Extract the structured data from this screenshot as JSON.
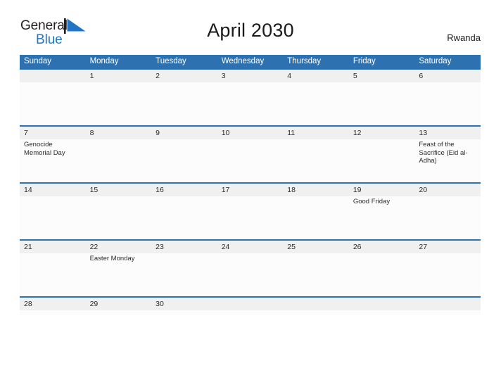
{
  "brand": {
    "line1": "General",
    "line2": "Blue",
    "flag_icon": "blue-triangle-flag-icon",
    "text_color": "#231f20",
    "accent_color": "#2076c4"
  },
  "header": {
    "title": "April 2030",
    "locale": "Rwanda"
  },
  "theme": {
    "header_blue": "#2e71b0",
    "daynum_band": "#f0f0f0",
    "cell_background": "#fcfcfc",
    "text": "#2b2b2b"
  },
  "calendar": {
    "month": "April",
    "year": "2030",
    "country": "Rwanda",
    "weekday_headers": [
      "Sunday",
      "Monday",
      "Tuesday",
      "Wednesday",
      "Thursday",
      "Friday",
      "Saturday"
    ],
    "weeks": [
      [
        {
          "day": "",
          "events": []
        },
        {
          "day": "1",
          "events": []
        },
        {
          "day": "2",
          "events": []
        },
        {
          "day": "3",
          "events": []
        },
        {
          "day": "4",
          "events": []
        },
        {
          "day": "5",
          "events": []
        },
        {
          "day": "6",
          "events": []
        }
      ],
      [
        {
          "day": "7",
          "events": [
            "Genocide Memorial Day"
          ]
        },
        {
          "day": "8",
          "events": []
        },
        {
          "day": "9",
          "events": []
        },
        {
          "day": "10",
          "events": []
        },
        {
          "day": "11",
          "events": []
        },
        {
          "day": "12",
          "events": []
        },
        {
          "day": "13",
          "events": [
            "Feast of the Sacrifice (Eid al-Adha)"
          ]
        }
      ],
      [
        {
          "day": "14",
          "events": []
        },
        {
          "day": "15",
          "events": []
        },
        {
          "day": "16",
          "events": []
        },
        {
          "day": "17",
          "events": []
        },
        {
          "day": "18",
          "events": []
        },
        {
          "day": "19",
          "events": [
            "Good Friday"
          ]
        },
        {
          "day": "20",
          "events": []
        }
      ],
      [
        {
          "day": "21",
          "events": []
        },
        {
          "day": "22",
          "events": [
            "Easter Monday"
          ]
        },
        {
          "day": "23",
          "events": []
        },
        {
          "day": "24",
          "events": []
        },
        {
          "day": "25",
          "events": []
        },
        {
          "day": "26",
          "events": []
        },
        {
          "day": "27",
          "events": []
        }
      ],
      [
        {
          "day": "28",
          "events": []
        },
        {
          "day": "29",
          "events": []
        },
        {
          "day": "30",
          "events": []
        },
        {
          "day": "",
          "events": []
        },
        {
          "day": "",
          "events": []
        },
        {
          "day": "",
          "events": []
        },
        {
          "day": "",
          "events": []
        }
      ]
    ]
  }
}
